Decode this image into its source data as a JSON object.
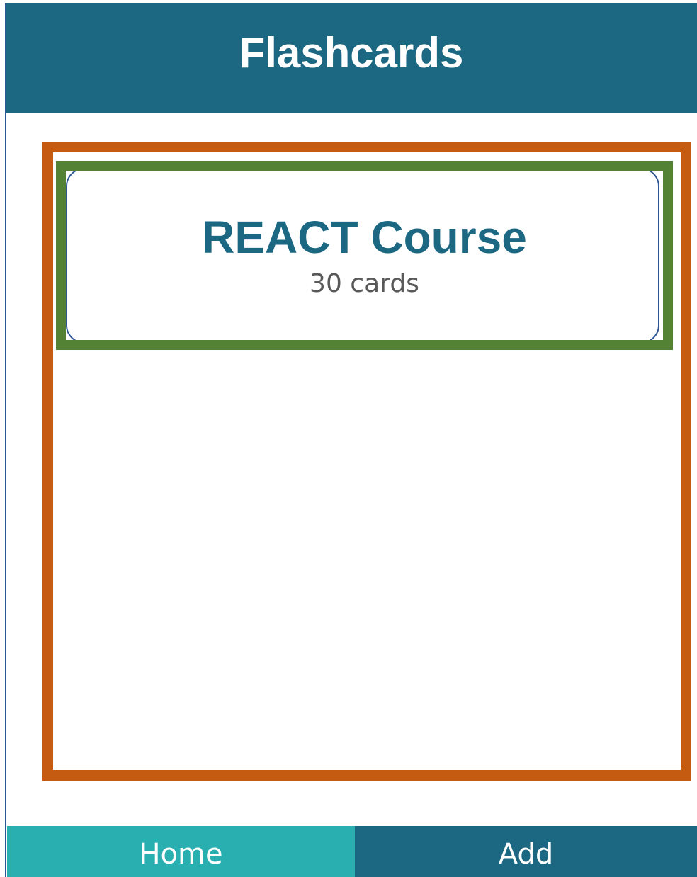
{
  "header": {
    "title": "Flashcards"
  },
  "deck_list": {
    "decks": [
      {
        "title": "REACT Course",
        "count_label": "30 cards"
      }
    ]
  },
  "bottom_nav": {
    "tabs": [
      {
        "label": "Home",
        "active": true
      },
      {
        "label": "Add",
        "active": false
      }
    ]
  },
  "colors": {
    "header_bg": "#1c6781",
    "active_tab_bg": "#2aafb0",
    "inactive_tab_bg": "#1c6781",
    "list_outline": "#c55a11",
    "deck_outline": "#548235",
    "deck_title": "#1c6781",
    "deck_count": "#595959"
  }
}
